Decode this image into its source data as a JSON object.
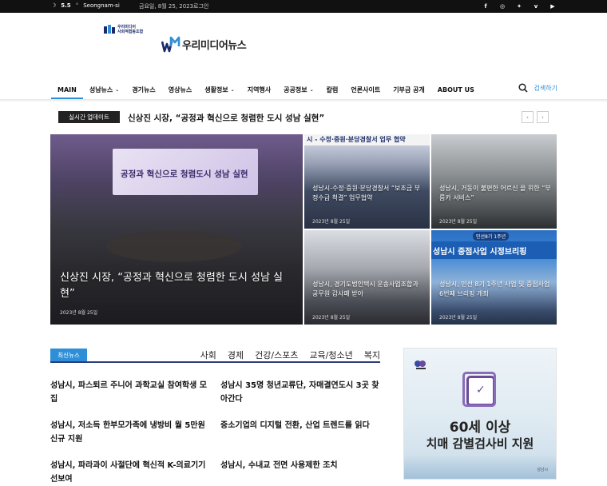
{
  "topbar": {
    "temperature": "5.5",
    "location": "Seongnam-si",
    "date": "금요일, 8월 25, 2023",
    "login": "로그인",
    "social_icons": [
      "facebook-icon",
      "instagram-icon",
      "twitter-icon",
      "vimeo-icon",
      "youtube-icon"
    ]
  },
  "header": {
    "partner_logo_text_1": "우리미디어",
    "partner_logo_text_2": "사회적협동조합",
    "site_logo": "우리미디어뉴스"
  },
  "nav": {
    "items": [
      {
        "label": "MAIN",
        "dropdown": false,
        "active": true
      },
      {
        "label": "성남뉴스",
        "dropdown": true,
        "active": false
      },
      {
        "label": "경기뉴스",
        "dropdown": false,
        "active": false
      },
      {
        "label": "영상뉴스",
        "dropdown": false,
        "active": false
      },
      {
        "label": "생활정보",
        "dropdown": true,
        "active": false
      },
      {
        "label": "지역행사",
        "dropdown": false,
        "active": false
      },
      {
        "label": "공공정보",
        "dropdown": true,
        "active": false
      },
      {
        "label": "칼럼",
        "dropdown": false,
        "active": false
      },
      {
        "label": "언론사이트",
        "dropdown": false,
        "active": false
      },
      {
        "label": "기부금 공개",
        "dropdown": false,
        "active": false
      },
      {
        "label": "ABOUT US",
        "dropdown": false,
        "active": false
      }
    ],
    "search_label": "검색하기"
  },
  "breaking": {
    "tag": "실시간 업데이트",
    "title": "신상진 시장, “공정과 혁신으로 청렴한 도시 성남 실현”"
  },
  "featured": {
    "main": {
      "banner_text": "공정과 혁신으로 청렴도시 성남 실현",
      "title": "신상진 시장, “공정과 혁신으로 청렴한 도시 성남 실현”",
      "date": "2023년 8월 25일"
    },
    "a": {
      "strip_text": "시 - 수정·중원·분당경찰서 업무 협약",
      "title": "성남시-수정·중원·분당경찰서 “보조금 부정수급 척결” 업무협약",
      "date": "2023년 8월 25일"
    },
    "b": {
      "title": "성남시, 거동이 불편한 어르신 을 위한 “부름카 서비스”",
      "date": "2023년 8월 25일"
    },
    "c": {
      "title": "성남시, 경기도법인택시 운송사업조합과 공무원 감사패 받아",
      "date": "2023년 8월 25일"
    },
    "d": {
      "pill": "민선8기 1주년",
      "strip_text": "성남시 중점사업 시정브리핑",
      "title": "성남시, 민선 8기 1주년 사업 및 중점사업 6번째 브리핑 개최",
      "date": "2023년 8월 25일"
    }
  },
  "latest": {
    "tag": "최신뉴스",
    "categories": [
      "사회",
      "경제",
      "건강/스포츠",
      "교육/청소년",
      "복지"
    ],
    "items": [
      "성남시, 파스퇴르 주니어 과학교실 참여학생 모집",
      "성남시 35명 청년교류단, 자매결연도시 3곳 찾아간다",
      "성남시, 저소득 한부모가족에 냉방비 월 5만원 신규 지원",
      "중소기업의 디지털 전환, 산업 트렌드를 읽다",
      "성남시, 파라과이 사절단에 혁신적 K-의료기기 선보여",
      "성남시, 수내교 전면 사용제한 조치"
    ]
  },
  "ad": {
    "line1": "60세 이상",
    "line2": "치매 감별검사비 지원",
    "footer": "성남시"
  },
  "colors": {
    "accent": "#2e8fd8",
    "dark": "#111111",
    "navy": "#2b3d7a"
  }
}
